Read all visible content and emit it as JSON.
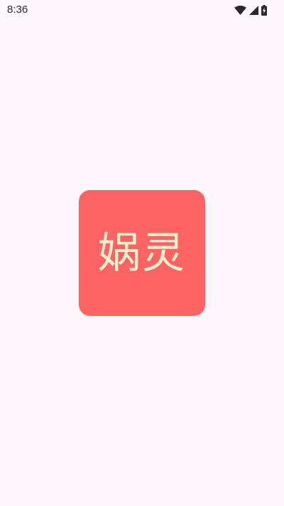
{
  "status_bar": {
    "time": "8:36",
    "icons": [
      "wifi-icon",
      "cellular-signal-icon",
      "battery-charging-icon"
    ]
  },
  "splash": {
    "logo_text": "娲灵",
    "logo_background_color": "#fe6363",
    "logo_text_color": "#fdf0cf"
  },
  "colors": {
    "page_background": "#fdf7fd",
    "status_text": "#2a2a2a"
  }
}
